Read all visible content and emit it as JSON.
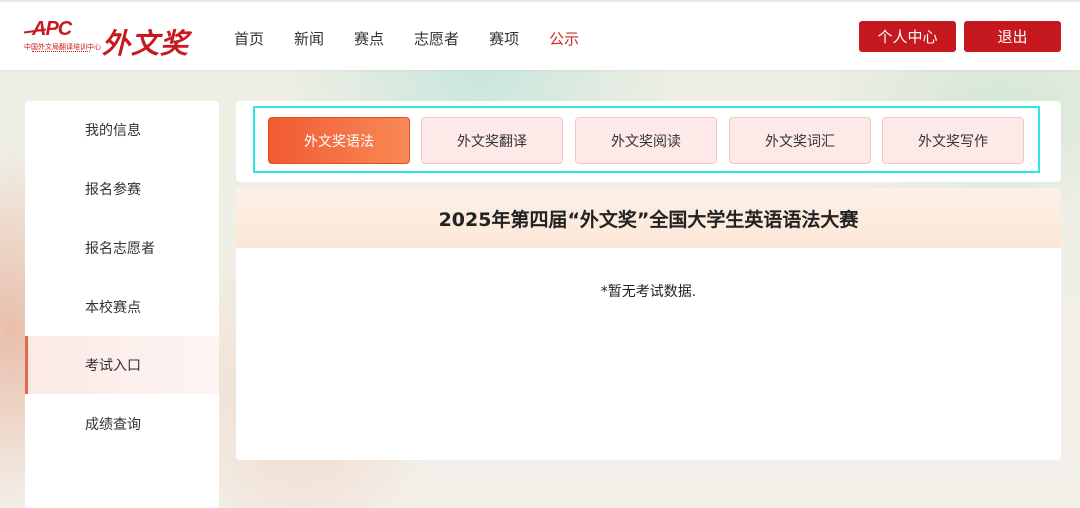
{
  "brand": {
    "logo_abbr": "APC",
    "logo_org": "中国外文局翻译培训中心",
    "logo_name": "外文奖"
  },
  "nav": {
    "items": [
      "首页",
      "新闻",
      "赛点",
      "志愿者",
      "赛项",
      "公示"
    ],
    "active_index": 5
  },
  "header_buttons": {
    "personal_center": "个人中心",
    "logout": "退出"
  },
  "sidebar": {
    "items": [
      "我的信息",
      "报名参赛",
      "报名志愿者",
      "本校赛点",
      "考试入口",
      "成绩查询"
    ],
    "active_index": 4
  },
  "tabs": {
    "items": [
      "外文奖语法",
      "外文奖翻译",
      "外文奖阅读",
      "外文奖词汇",
      "外文奖写作"
    ],
    "active_index": 0
  },
  "content": {
    "title": "2025年第四届“外文奖”全国大学生英语语法大赛",
    "empty_message": "*暂无考试数据."
  },
  "colors": {
    "brand_red": "#c5191f",
    "nav_active": "#d02a2a",
    "tab_active": "#f05a31",
    "highlight_frame": "#2ee5e8"
  }
}
